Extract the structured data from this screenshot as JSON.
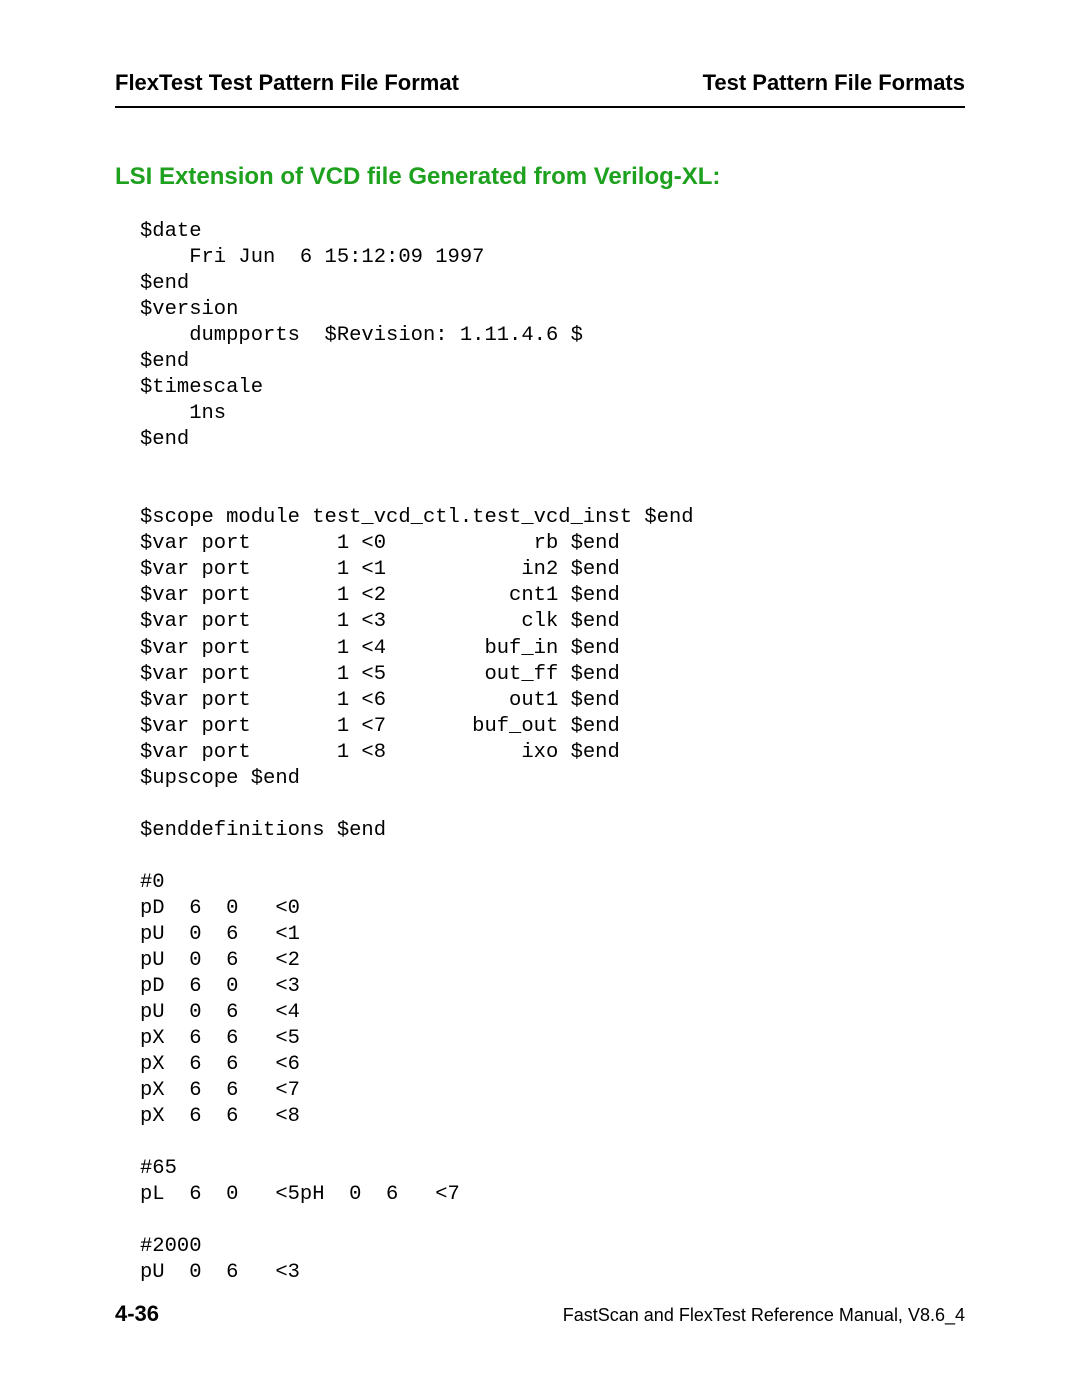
{
  "header": {
    "left": "FlexTest Test Pattern File Format",
    "right": "Test Pattern File Formats"
  },
  "section": {
    "heading": "LSI Extension of VCD file Generated from Verilog-XL:"
  },
  "code": "$date\n    Fri Jun  6 15:12:09 1997\n$end\n$version\n    dumpports  $Revision: 1.11.4.6 $\n$end\n$timescale\n    1ns\n$end\n\n\n$scope module test_vcd_ctl.test_vcd_inst $end\n$var port       1 <0            rb $end\n$var port       1 <1           in2 $end\n$var port       1 <2          cnt1 $end\n$var port       1 <3           clk $end\n$var port       1 <4        buf_in $end\n$var port       1 <5        out_ff $end\n$var port       1 <6          out1 $end\n$var port       1 <7       buf_out $end\n$var port       1 <8           ixo $end\n$upscope $end\n\n$enddefinitions $end\n\n#0\npD  6  0   <0\npU  0  6   <1\npU  0  6   <2\npD  6  0   <3\npU  0  6   <4\npX  6  6   <5\npX  6  6   <6\npX  6  6   <7\npX  6  6   <8\n\n#65\npL  6  0   <5pH  0  6   <7\n\n#2000\npU  0  6   <3",
  "footer": {
    "page": "4-36",
    "manual": "FastScan and FlexTest Reference Manual, V8.6_4"
  }
}
